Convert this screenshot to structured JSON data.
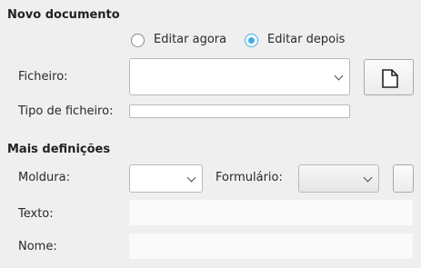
{
  "new_document": {
    "title": "Novo documento",
    "radio_edit_now": "Editar agora",
    "radio_edit_later": "Editar depois",
    "selected": "edit_later",
    "file_label": "Ficheiro:",
    "file_value": "",
    "file_type_label": "Tipo de ficheiro:",
    "file_type_value": ""
  },
  "more_settings": {
    "title": "Mais definições",
    "frame_label": "Moldura:",
    "frame_value": "",
    "form_label": "Formulário:",
    "form_value": "",
    "text_label": "Texto:",
    "text_value": "",
    "name_label": "Nome:",
    "name_value": ""
  },
  "icons": {
    "new_file": "document-icon",
    "dropdown": "chevron-down-icon"
  },
  "colors": {
    "accent": "#3daee9",
    "background": "#efefef"
  }
}
